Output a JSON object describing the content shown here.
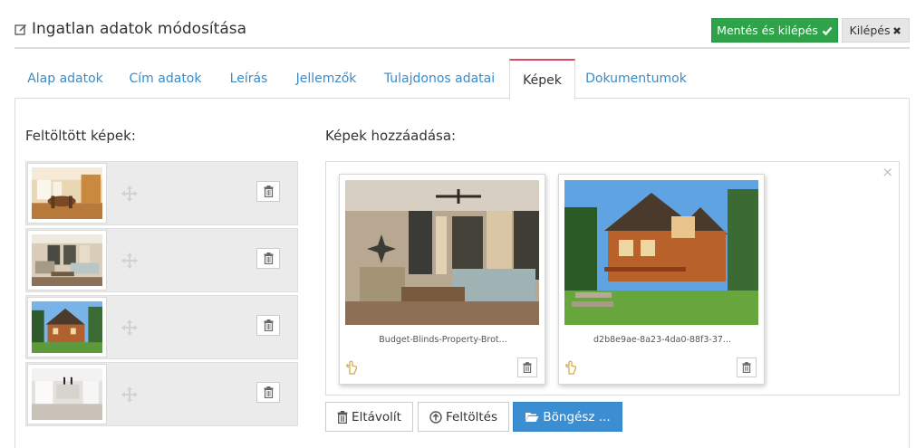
{
  "header": {
    "title": "Ingatlan adatok módosítása",
    "title_icon": "edit-icon",
    "save_label": "Mentés és kilépés",
    "exit_label": "Kilépés",
    "save_color": "#2fa34a"
  },
  "tabs": [
    {
      "label": "Alap adatok"
    },
    {
      "label": "Cím adatok"
    },
    {
      "label": "Leírás"
    },
    {
      "label": "Jellemzők"
    },
    {
      "label": "Tulajdonos adatai"
    },
    {
      "label": "Képek",
      "active": true
    },
    {
      "label": "Dokumentumok"
    }
  ],
  "uploaded": {
    "heading": "Feltöltött képek:",
    "items": [
      {
        "image": "dining-room-photo"
      },
      {
        "image": "living-room-photo"
      },
      {
        "image": "wooden-house-photo"
      },
      {
        "image": "white-kitchen-photo"
      }
    ]
  },
  "add_images": {
    "heading": "Képek hozzáadása:",
    "previews": [
      {
        "file_name": "Budget-Blinds-Property-Brot...",
        "image": "living-room-photo"
      },
      {
        "file_name": "d2b8e9ae-8a23-4da0-88f3-37...",
        "image": "wooden-house-photo"
      }
    ],
    "close_symbol": "×"
  },
  "actions": {
    "remove_label": "Eltávolít",
    "upload_label": "Feltöltés",
    "browse_label": "Böngész ...",
    "browse_color": "#3c8ed3"
  }
}
